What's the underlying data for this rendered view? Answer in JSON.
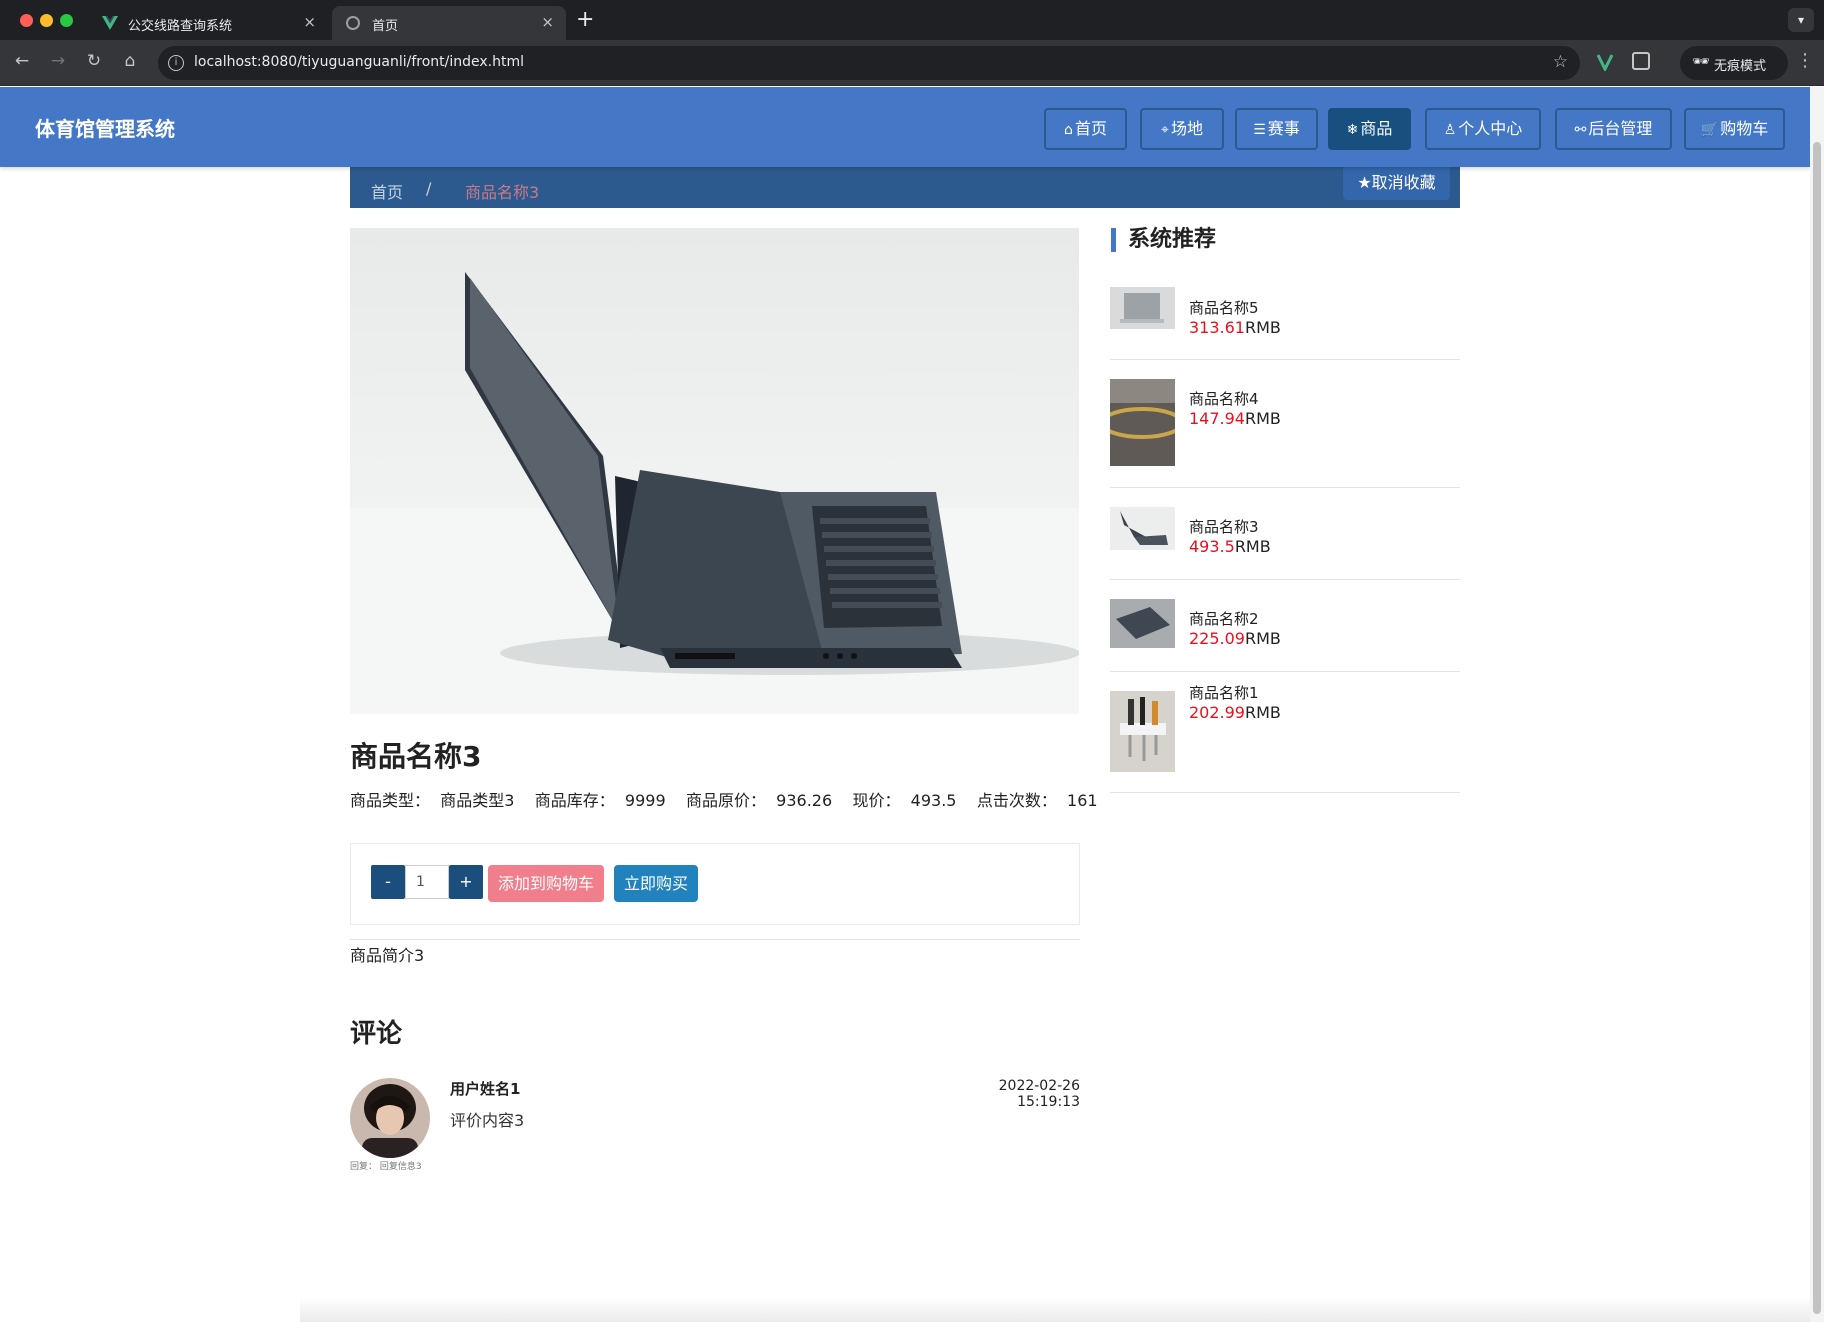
{
  "browser": {
    "tabs": [
      {
        "title": "公交线路查询系统",
        "close": "×"
      },
      {
        "title": "首页",
        "close": "×"
      }
    ],
    "new_tab": "+",
    "url": "localhost:8080/tiyuguanguanli/front/index.html",
    "incognito_label": "无痕模式"
  },
  "header": {
    "site_title": "体育馆管理系统",
    "nav": [
      {
        "label": "首页",
        "icon": "home-icon"
      },
      {
        "label": "场地",
        "icon": "tag-icon"
      },
      {
        "label": "赛事",
        "icon": "sliders-icon"
      },
      {
        "label": "商品",
        "icon": "snowflake-icon",
        "active": true
      },
      {
        "label": "个人中心",
        "icon": "user-icon"
      },
      {
        "label": "后台管理",
        "icon": "link-icon"
      },
      {
        "label": "购物车",
        "icon": "cart-icon"
      }
    ]
  },
  "breadcrumb": {
    "home": "首页",
    "separator": "/",
    "current": "商品名称3",
    "uncollect_label": "取消收藏"
  },
  "product": {
    "name": "商品名称3",
    "meta": {
      "type_label": "商品类型：",
      "type_value": "商品类型3",
      "stock_label": "商品库存：",
      "stock_value": "9999",
      "original_label": "商品原价：",
      "original_value": "936.26",
      "price_label": "现价：",
      "price_value": "493.5",
      "clicks_label": "点击次数：",
      "clicks_value": "161"
    },
    "quantity": "1",
    "minus": "-",
    "plus": "+",
    "add_to_cart": "添加到购物车",
    "buy_now": "立即购买",
    "description": "商品简介3"
  },
  "comments": {
    "heading": "评论",
    "items": [
      {
        "user": "用户姓名1",
        "time": "2022-02-26 15:19:13",
        "content": "评价内容3",
        "reply": "回复：  回复信息3"
      }
    ]
  },
  "recommend": {
    "title": "系统推荐",
    "items": [
      {
        "name": "商品名称5",
        "price": "313.61",
        "unit": "RMB"
      },
      {
        "name": "商品名称4",
        "price": "147.94",
        "unit": "RMB"
      },
      {
        "name": "商品名称3",
        "price": "493.5",
        "unit": "RMB"
      },
      {
        "name": "商品名称2",
        "price": "225.09",
        "unit": "RMB"
      },
      {
        "name": "商品名称1",
        "price": "202.99",
        "unit": "RMB"
      }
    ]
  },
  "colors": {
    "header": "#4478c6",
    "breadcrumb": "#2d5a8e",
    "price_red": "#e8101f",
    "add_cart": "#f07e8b",
    "buy_now": "#2182bd"
  }
}
